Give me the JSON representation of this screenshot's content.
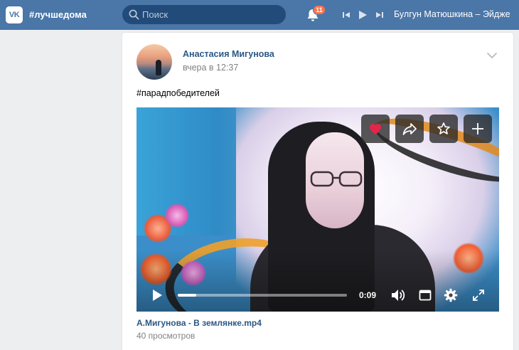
{
  "header": {
    "logo_text": "VK",
    "hashtag": "#лучшедома",
    "search_placeholder": "Поиск",
    "notifications_count": "11",
    "now_playing": "Булгун Матюшкина – Эйдже",
    "brand_color": "#4a76a8"
  },
  "post": {
    "author": "Анастасия Мигунова",
    "time": "вчера в 12:37",
    "text": "#парадпобедителей",
    "video": {
      "time": "0:09",
      "progress": 0.11,
      "title": "А.Мигунова - В землянке.mp4",
      "views": "40 просмотров",
      "actions": [
        "heart-icon",
        "share-icon",
        "star-icon",
        "plus-icon"
      ],
      "controls": [
        "play-icon",
        "volume-icon",
        "miniplayer-icon",
        "settings-icon",
        "fullscreen-icon"
      ]
    }
  }
}
